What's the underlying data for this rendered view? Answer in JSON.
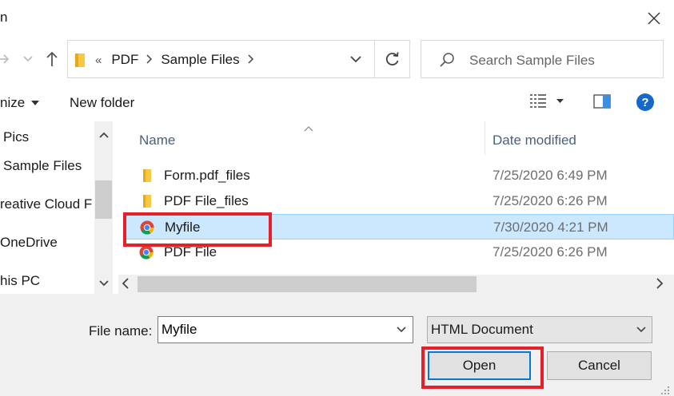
{
  "window": {
    "title": "n"
  },
  "address": {
    "prefix": "«",
    "crumbs": [
      "PDF",
      "Sample Files"
    ]
  },
  "search": {
    "placeholder": "Search Sample Files"
  },
  "toolbar": {
    "organize_label": "nize",
    "new_folder_label": "New folder"
  },
  "sidebar": {
    "items": [
      "Pics",
      "Sample Files",
      "reative Cloud F",
      "OneDrive",
      "his PC"
    ]
  },
  "columns": {
    "name": "Name",
    "date": "Date modified"
  },
  "files": [
    {
      "name": "Form.pdf_files",
      "date": "7/25/2020 6:49 PM",
      "type": "folder",
      "selected": false
    },
    {
      "name": "PDF File_files",
      "date": "7/25/2020 6:26 PM",
      "type": "folder",
      "selected": false
    },
    {
      "name": "Myfile",
      "date": "7/30/2020 4:21 PM",
      "type": "chrome-html",
      "selected": true
    },
    {
      "name": "PDF File",
      "date": "7/25/2020 6:26 PM",
      "type": "chrome-html",
      "selected": false
    }
  ],
  "footer": {
    "file_name_label": "File name:",
    "file_name_value": "Myfile",
    "file_type": "HTML Document",
    "open_label": "Open",
    "cancel_label": "Cancel"
  },
  "colors": {
    "selection": "#cce8ff",
    "highlight": "#e5202a",
    "accent": "#0078d7"
  }
}
